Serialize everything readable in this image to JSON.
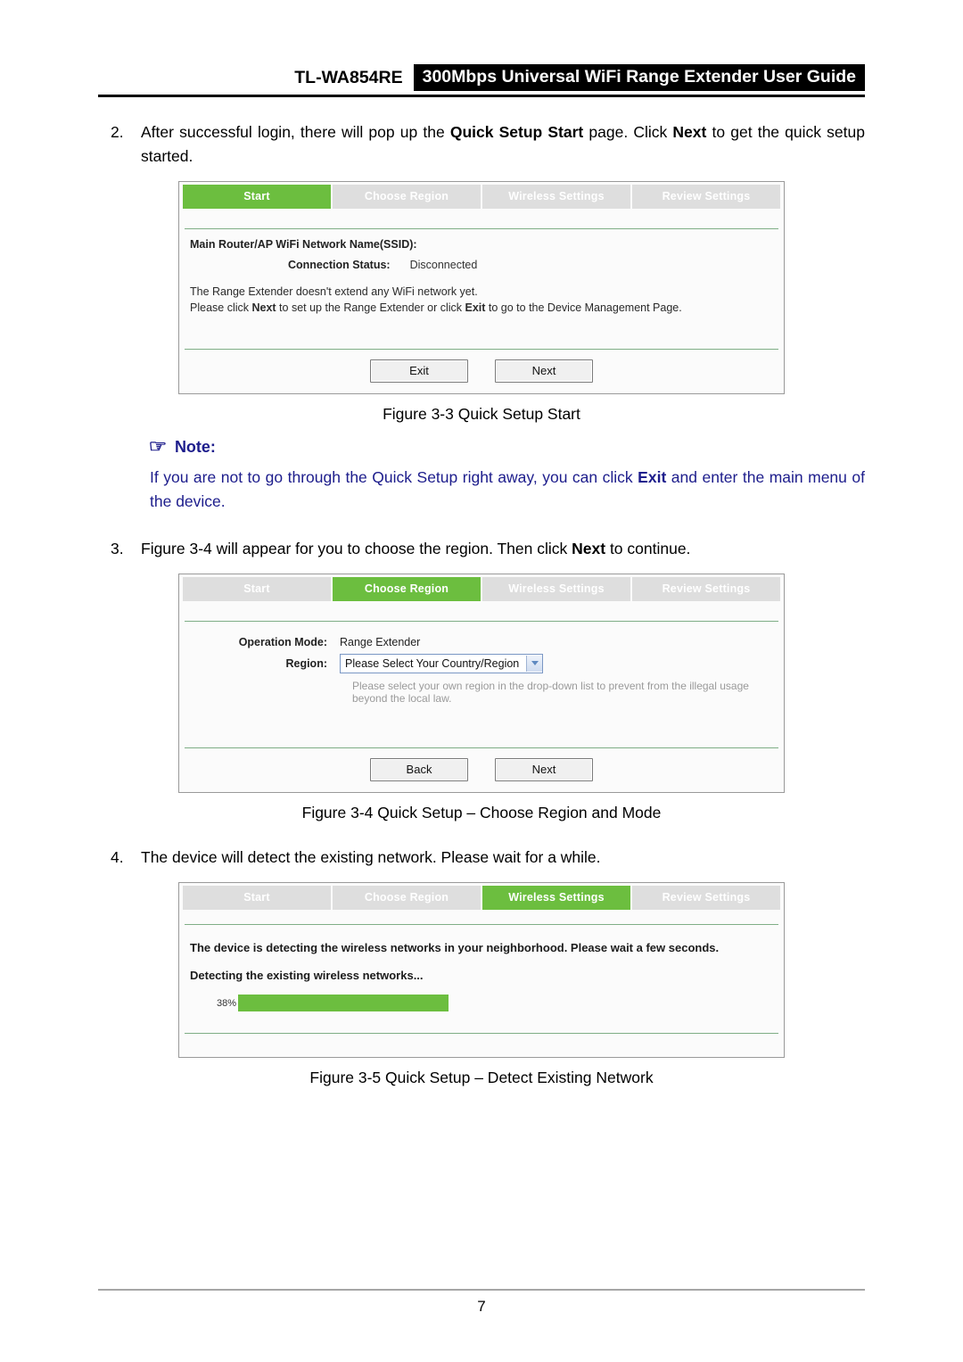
{
  "header": {
    "model": "TL-WA854RE",
    "title": "300Mbps Universal WiFi Range Extender User Guide"
  },
  "steps": {
    "two": {
      "number": "2.",
      "part1": "After successful login, there will pop up the ",
      "bold1": "Quick Setup Start",
      "part2": " page. Click ",
      "bold2": "Next",
      "part3": " to get the quick setup started."
    },
    "three": {
      "number": "3.",
      "part1": "Figure 3-4 will appear for you to choose the region. Then click ",
      "bold1": "Next",
      "part2": " to continue."
    },
    "four": {
      "number": "4.",
      "text": "The device will detect the existing network. Please wait for a while."
    }
  },
  "note": {
    "icon": "pointing-hand-icon",
    "heading": "Note:",
    "part1": "If you are not to go through the Quick Setup right away, you can click ",
    "bold1": "Exit",
    "part2": " and enter the main menu of the device."
  },
  "figure33": {
    "caption": "Figure 3-3 Quick Setup Start",
    "tabs": [
      {
        "label": "Start",
        "active": true
      },
      {
        "label": "Choose Region",
        "active": false
      },
      {
        "label": "Wireless Settings",
        "active": false
      },
      {
        "label": "Review Settings",
        "active": false
      }
    ],
    "ssid_label": "Main Router/AP WiFi Network Name(SSID):",
    "status_label": "Connection Status:",
    "status_value": "Disconnected",
    "line1": "The Range Extender doesn't extend any WiFi network yet.",
    "line2_a": "Please click ",
    "line2_b": "Next",
    "line2_c": " to set up the Range Extender or click ",
    "line2_d": "Exit",
    "line2_e": " to go to the Device Management Page.",
    "buttons": {
      "exit": "Exit",
      "next": "Next"
    }
  },
  "figure34": {
    "caption": "Figure 3-4 Quick Setup – Choose Region and Mode",
    "tabs": [
      {
        "label": "Start",
        "active": false
      },
      {
        "label": "Choose Region",
        "active": true
      },
      {
        "label": "Wireless Settings",
        "active": false
      },
      {
        "label": "Review Settings",
        "active": false
      }
    ],
    "operation_mode_label": "Operation Mode:",
    "operation_mode_value": "Range Extender",
    "region_label": "Region:",
    "region_value": "Please Select Your Country/Region",
    "region_hint": "Please select your own region in the drop-down list to prevent from the illegal usage beyond the local law.",
    "buttons": {
      "back": "Back",
      "next": "Next"
    }
  },
  "figure35": {
    "caption": "Figure 3-5 Quick Setup – Detect Existing Network",
    "tabs": [
      {
        "label": "Start",
        "active": false
      },
      {
        "label": "Choose Region",
        "active": false
      },
      {
        "label": "Wireless Settings",
        "active": true
      },
      {
        "label": "Review Settings",
        "active": false
      }
    ],
    "line1": "The device is detecting the wireless networks in your neighborhood. Please wait a few seconds.",
    "line2": "Detecting the existing wireless networks...",
    "progress_percent": "38%",
    "progress_value": 38
  },
  "footer": {
    "page_number": "7"
  },
  "colors": {
    "accent_green": "#6cbe3f",
    "tab_inactive": "#dedede",
    "note_blue": "#1d1d8c",
    "rule_green": "#7fae86"
  }
}
